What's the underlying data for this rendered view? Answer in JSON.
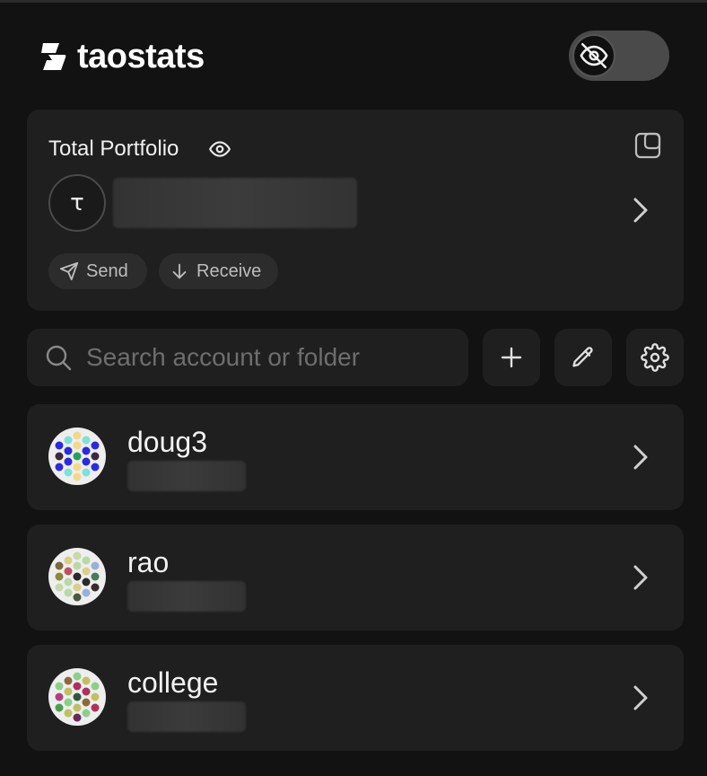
{
  "app": {
    "logo_text": "taostats"
  },
  "header": {
    "privacy_toggle_icon": "eye-off-icon",
    "privacy_mode_on": true
  },
  "portfolio": {
    "title": "Total Portfolio",
    "currency_symbol": "τ",
    "send_label": "Send",
    "receive_label": "Receive"
  },
  "search": {
    "placeholder": "Search account or folder",
    "value": ""
  },
  "toolbar": {
    "add_icon": "plus-icon",
    "edit_icon": "pencil-icon",
    "settings_icon": "gear-icon"
  },
  "accounts": [
    {
      "name": "doug3"
    },
    {
      "name": "rao"
    },
    {
      "name": "college"
    }
  ],
  "colors": {
    "background": "#121212",
    "card": "#1f1f1f",
    "pill": "#2c2c2c",
    "text": "#f2f2f2",
    "muted": "#6e6e6e"
  }
}
